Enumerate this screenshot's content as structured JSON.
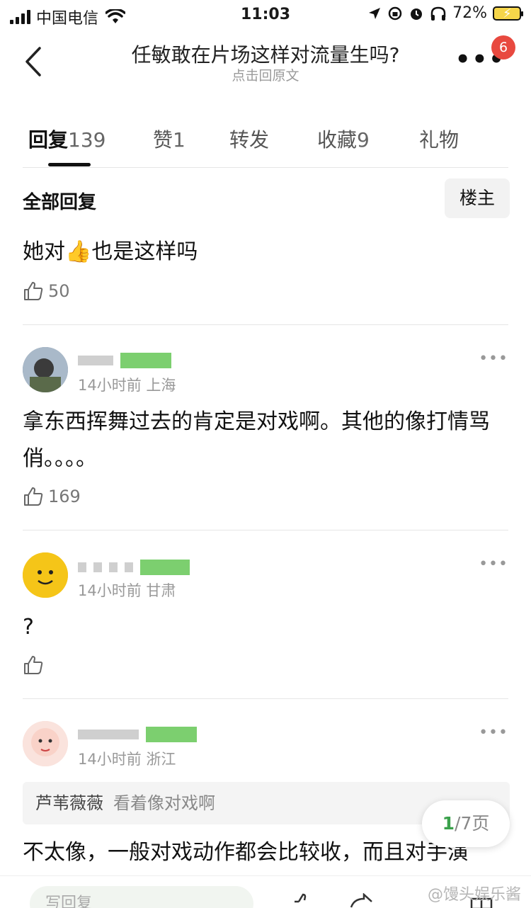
{
  "status_bar": {
    "carrier": "中国电信",
    "time": "11:03",
    "battery": "72%"
  },
  "nav": {
    "title": "任敏敢在片场这样对流量生吗?",
    "subtitle": "点击回原文",
    "badge": "6"
  },
  "tabs": [
    {
      "label": "回复",
      "count": "139"
    },
    {
      "label": "赞",
      "count": "1"
    },
    {
      "label": "转发",
      "count": ""
    },
    {
      "label": "收藏",
      "count": "9"
    },
    {
      "label": "礼物",
      "count": ""
    }
  ],
  "section": {
    "all_replies": "全部回复",
    "op_button": "楼主"
  },
  "post": {
    "text_before": "她对",
    "text_after": "也是这样吗",
    "likes": "50"
  },
  "comments": [
    {
      "meta": "14小时前 上海",
      "text": "拿东西挥舞过去的肯定是对戏啊。其他的像打情骂俏。。。。",
      "likes": "169"
    },
    {
      "meta": "14小时前 甘肃",
      "text": "?",
      "likes": ""
    },
    {
      "meta": "14小时前 浙江",
      "quote_name": "芦苇薇薇",
      "quote_text": "看着像对戏啊",
      "text": "不太像，一般对戏动作都会比较收，而且对手演"
    }
  ],
  "pager": {
    "current": "1",
    "total": "/7页"
  },
  "bottom": {
    "input_placeholder": "写回复",
    "watermark": "@馒头娱乐酱"
  }
}
